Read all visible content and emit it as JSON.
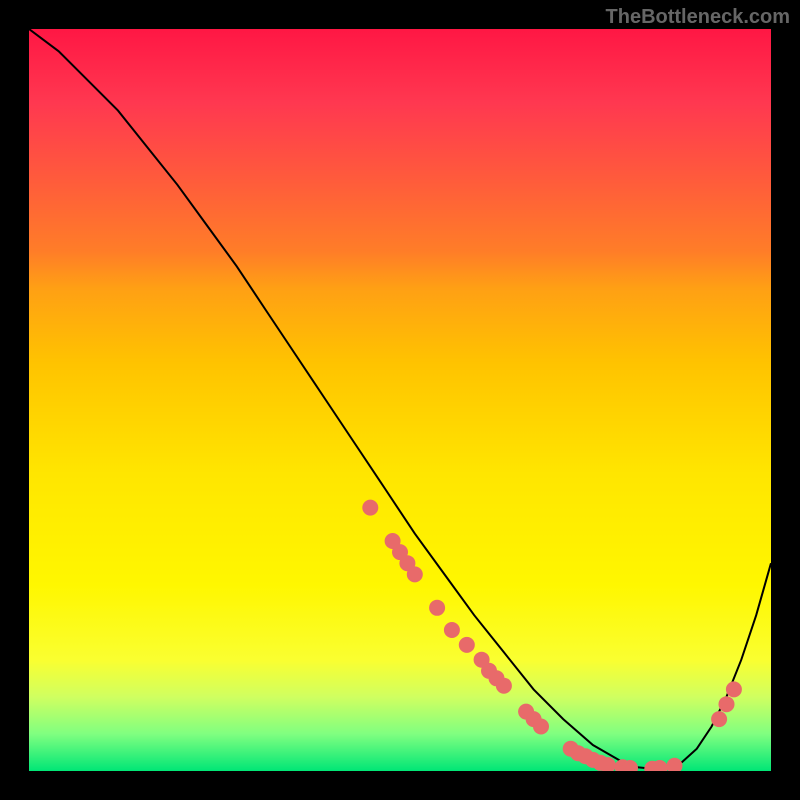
{
  "watermark": "TheBottleneck.com",
  "chart_data": {
    "type": "line",
    "title": "",
    "xlabel": "",
    "ylabel": "",
    "xlim": [
      0,
      100
    ],
    "ylim": [
      0,
      100
    ],
    "grid": false,
    "background": "heat-gradient",
    "series": [
      {
        "name": "bottleneck-curve",
        "x": [
          0,
          4,
          8,
          12,
          16,
          20,
          24,
          28,
          32,
          36,
          40,
          44,
          48,
          52,
          56,
          60,
          64,
          68,
          72,
          76,
          80,
          82,
          84,
          86,
          88,
          90,
          92,
          94,
          96,
          98,
          100
        ],
        "values": [
          100,
          97,
          93,
          89,
          84,
          79,
          73.5,
          68,
          62,
          56,
          50,
          44,
          38,
          32,
          26.5,
          21,
          16,
          11,
          7,
          3.5,
          1.2,
          0.5,
          0.3,
          0.5,
          1.2,
          3,
          6,
          10,
          15,
          21,
          28
        ]
      }
    ],
    "scatter_on_curve": [
      {
        "x": 46,
        "y": 35.5
      },
      {
        "x": 49,
        "y": 31
      },
      {
        "x": 50,
        "y": 29.5
      },
      {
        "x": 51,
        "y": 28
      },
      {
        "x": 52,
        "y": 26.5
      },
      {
        "x": 55,
        "y": 22
      },
      {
        "x": 57,
        "y": 19
      },
      {
        "x": 59,
        "y": 17
      },
      {
        "x": 61,
        "y": 15
      },
      {
        "x": 62,
        "y": 13.5
      },
      {
        "x": 63,
        "y": 12.5
      },
      {
        "x": 64,
        "y": 11.5
      },
      {
        "x": 67,
        "y": 8
      },
      {
        "x": 68,
        "y": 7
      },
      {
        "x": 69,
        "y": 6
      },
      {
        "x": 73,
        "y": 3
      },
      {
        "x": 74,
        "y": 2.4
      },
      {
        "x": 75,
        "y": 2
      },
      {
        "x": 76,
        "y": 1.5
      },
      {
        "x": 77,
        "y": 1.1
      },
      {
        "x": 78,
        "y": 0.8
      },
      {
        "x": 80,
        "y": 0.5
      },
      {
        "x": 81,
        "y": 0.4
      },
      {
        "x": 84,
        "y": 0.3
      },
      {
        "x": 85,
        "y": 0.4
      },
      {
        "x": 87,
        "y": 0.7
      },
      {
        "x": 93,
        "y": 7
      },
      {
        "x": 94,
        "y": 9
      },
      {
        "x": 95,
        "y": 11
      }
    ],
    "scatter_style": {
      "color": "#e86a6a",
      "radius": 8
    },
    "curve_style": {
      "color": "#000000",
      "width": 2
    }
  }
}
